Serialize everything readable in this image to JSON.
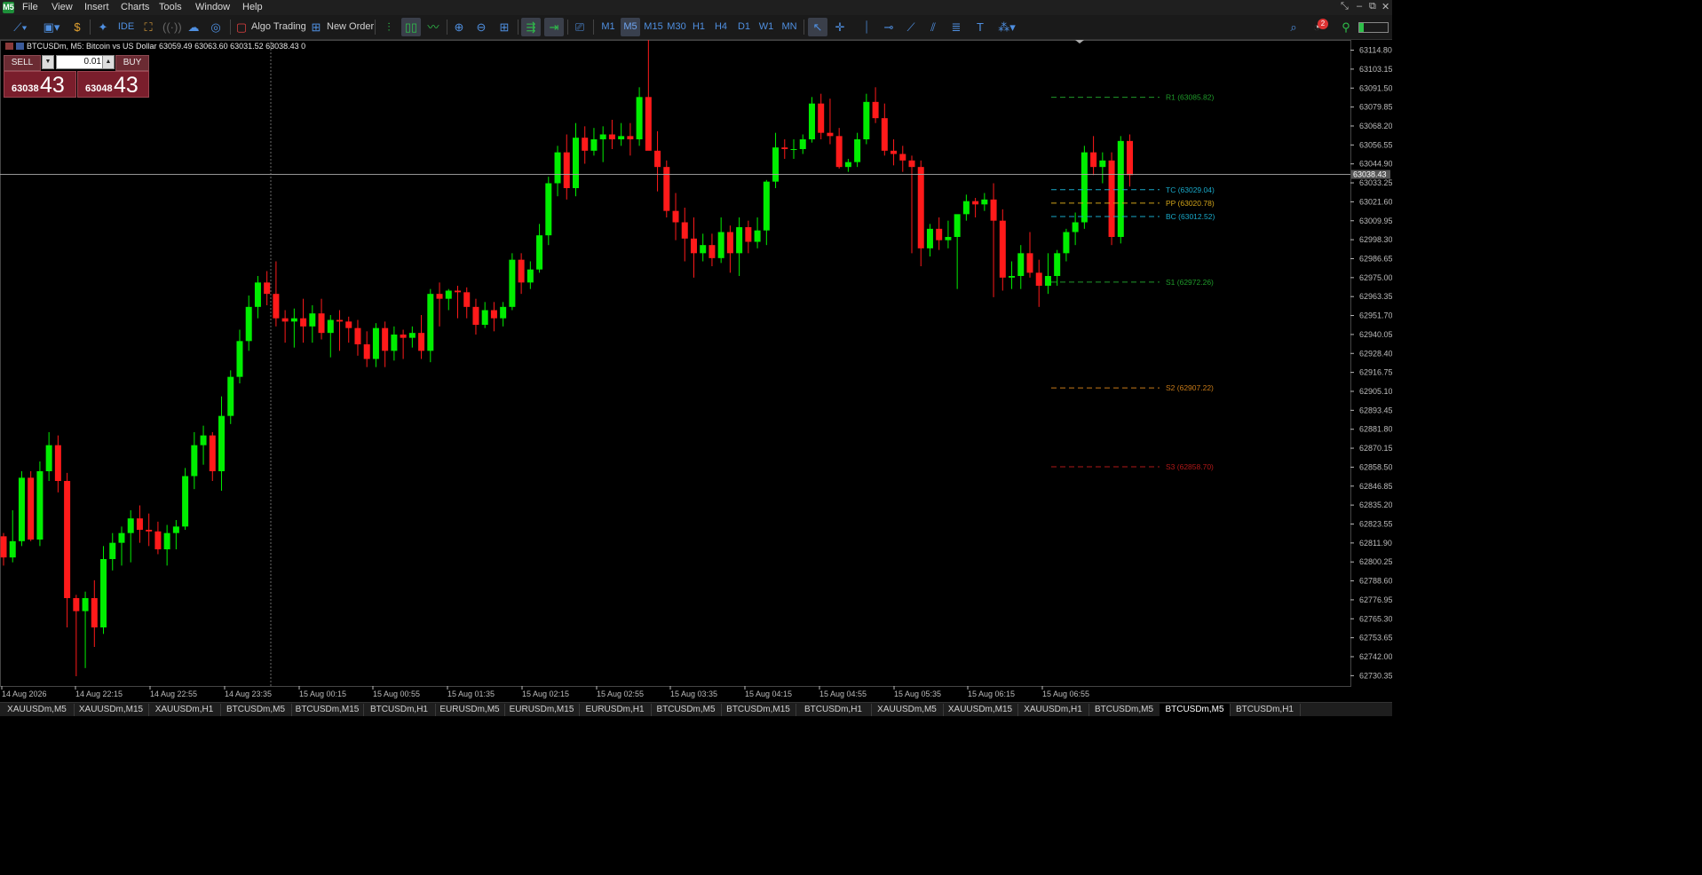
{
  "menu": {
    "logo_label": "M5",
    "items": [
      "File",
      "View",
      "Insert",
      "Charts",
      "Tools",
      "Window",
      "Help"
    ],
    "window_controls": [
      "⤡",
      "–",
      "⧉",
      "✕"
    ]
  },
  "toolbar": {
    "algo_trading_label": "Algo Trading",
    "new_order_label": "New Order",
    "ide_label": "IDE",
    "timeframes": [
      "M1",
      "M5",
      "M15",
      "M30",
      "H1",
      "H4",
      "D1",
      "W1",
      "MN"
    ],
    "active_timeframe": "M5",
    "notifications_count": "2"
  },
  "symbol_info": {
    "text": "BTCUSDm, M5:  Bitcoin vs US Dollar  63059.49 63063.60 63031.52 63038.43  0"
  },
  "trade_panel": {
    "sell_label": "SELL",
    "buy_label": "BUY",
    "lot_value": "0.01",
    "sell_price_small": "63038",
    "sell_price_big": "43",
    "buy_price_small": "63048",
    "buy_price_big": "43"
  },
  "chart_data": {
    "type": "candlestick",
    "symbol": "BTCUSDm",
    "timeframe": "M5",
    "ylim": [
      62724.0,
      63120.0
    ],
    "current_price": 63038.43,
    "current_price_label": "63038.43",
    "y_ticks": [
      "63114.80",
      "63103.15",
      "63091.50",
      "63079.85",
      "63068.20",
      "63056.55",
      "63044.90",
      "63033.25",
      "63021.60",
      "63009.95",
      "62998.30",
      "62986.65",
      "62975.00",
      "62963.35",
      "62951.70",
      "62940.05",
      "62928.40",
      "62916.75",
      "62905.10",
      "62893.45",
      "62881.80",
      "62870.15",
      "62858.50",
      "62846.85",
      "62835.20",
      "62823.55",
      "62811.90",
      "62800.25",
      "62788.60",
      "62776.95",
      "62765.30",
      "62753.65",
      "62742.00",
      "62730.35"
    ],
    "x_tick_labels": [
      "14 Aug 2026",
      "14 Aug 22:15",
      "14 Aug 22:55",
      "14 Aug 23:35",
      "15 Aug 00:15",
      "15 Aug 00:55",
      "15 Aug 01:35",
      "15 Aug 02:15",
      "15 Aug 02:55",
      "15 Aug 03:35",
      "15 Aug 04:15",
      "15 Aug 04:55",
      "15 Aug 05:35",
      "15 Aug 06:15",
      "15 Aug 06:55"
    ],
    "candles": [
      [
        62816,
        62818,
        62798,
        62803
      ],
      [
        62803,
        62832,
        62800,
        62813
      ],
      [
        62813,
        62856,
        62810,
        62852
      ],
      [
        62852,
        62856,
        62813,
        62814
      ],
      [
        62814,
        62862,
        62810,
        62856
      ],
      [
        62856,
        62880,
        62850,
        62872
      ],
      [
        62872,
        62878,
        62843,
        62850
      ],
      [
        62850,
        62855,
        62760,
        62778
      ],
      [
        62778,
        62780,
        62730,
        62770
      ],
      [
        62770,
        62782,
        62735,
        62778
      ],
      [
        62778,
        62789,
        62748,
        62760
      ],
      [
        62760,
        62810,
        62756,
        62802
      ],
      [
        62802,
        62818,
        62795,
        62812
      ],
      [
        62812,
        62822,
        62798,
        62818
      ],
      [
        62818,
        62832,
        62800,
        62827
      ],
      [
        62827,
        62835,
        62812,
        62820
      ],
      [
        62820,
        62830,
        62810,
        62819
      ],
      [
        62819,
        62825,
        62805,
        62808
      ],
      [
        62808,
        62823,
        62798,
        62818
      ],
      [
        62818,
        62826,
        62808,
        62822
      ],
      [
        62822,
        62858,
        62820,
        62853
      ],
      [
        62853,
        62880,
        62845,
        62872
      ],
      [
        62872,
        62884,
        62860,
        62878
      ],
      [
        62878,
        62880,
        62850,
        62856
      ],
      [
        62856,
        62902,
        62844,
        62890
      ],
      [
        62890,
        62918,
        62885,
        62914
      ],
      [
        62914,
        62943,
        62910,
        62936
      ],
      [
        62936,
        62964,
        62930,
        62957
      ],
      [
        62957,
        62976,
        62950,
        62972
      ],
      [
        62972,
        62979,
        62958,
        62965
      ],
      [
        62965,
        62985,
        62945,
        62950
      ],
      [
        62950,
        62955,
        62935,
        62948
      ],
      [
        62948,
        62956,
        62932,
        62950
      ],
      [
        62950,
        62962,
        62935,
        62945
      ],
      [
        62945,
        62958,
        62935,
        62953
      ],
      [
        62953,
        62962,
        62937,
        62941
      ],
      [
        62941,
        62952,
        62926,
        62949
      ],
      [
        62949,
        62955,
        62930,
        62948
      ],
      [
        62948,
        62951,
        62935,
        62944
      ],
      [
        62944,
        62949,
        62927,
        62934
      ],
      [
        62934,
        62942,
        62920,
        62925
      ],
      [
        62925,
        62947,
        62920,
        62944
      ],
      [
        62944,
        62948,
        62920,
        62930
      ],
      [
        62930,
        62945,
        62924,
        62940
      ],
      [
        62940,
        62943,
        62925,
        62938
      ],
      [
        62938,
        62945,
        62932,
        62941
      ],
      [
        62941,
        62952,
        62925,
        62930
      ],
      [
        62930,
        62968,
        62923,
        62965
      ],
      [
        62965,
        62972,
        62945,
        62962
      ],
      [
        62962,
        62968,
        62955,
        62967
      ],
      [
        62967,
        62970,
        62950,
        62966
      ],
      [
        62966,
        62969,
        62950,
        62957
      ],
      [
        62957,
        62962,
        62940,
        62946
      ],
      [
        62946,
        62960,
        62944,
        62955
      ],
      [
        62955,
        62960,
        62942,
        62950
      ],
      [
        62950,
        62960,
        62945,
        62957
      ],
      [
        62957,
        62990,
        62955,
        62986
      ],
      [
        62986,
        62990,
        62965,
        62972
      ],
      [
        62972,
        62985,
        62968,
        62980
      ],
      [
        62980,
        63008,
        62978,
        63001
      ],
      [
        63001,
        63037,
        62995,
        63033
      ],
      [
        63033,
        63056,
        63025,
        63052
      ],
      [
        63052,
        63063,
        63023,
        63030
      ],
      [
        63030,
        63070,
        63025,
        63061
      ],
      [
        63061,
        63068,
        63045,
        63053
      ],
      [
        63053,
        63067,
        63050,
        63060
      ],
      [
        63060,
        63068,
        63046,
        63063
      ],
      [
        63063,
        63072,
        63054,
        63060
      ],
      [
        63060,
        63070,
        63056,
        63062
      ],
      [
        63062,
        63070,
        63050,
        63060
      ],
      [
        63060,
        63092,
        63056,
        63086
      ],
      [
        63086,
        63124,
        63056,
        63053
      ],
      [
        63053,
        63065,
        63028,
        63043
      ],
      [
        63043,
        63047,
        63012,
        63016
      ],
      [
        63016,
        63027,
        62998,
        63009
      ],
      [
        63009,
        63018,
        62985,
        62999
      ],
      [
        62999,
        63012,
        62975,
        62990
      ],
      [
        62990,
        63002,
        62985,
        62995
      ],
      [
        62995,
        63002,
        62982,
        62987
      ],
      [
        62987,
        63012,
        62984,
        63003
      ],
      [
        63003,
        63007,
        62978,
        62990
      ],
      [
        62990,
        63012,
        62976,
        63006
      ],
      [
        63006,
        63010,
        62990,
        62997
      ],
      [
        62997,
        63012,
        62993,
        63004
      ],
      [
        63004,
        63035,
        62995,
        63034
      ],
      [
        63034,
        63064,
        63030,
        63055
      ],
      [
        63055,
        63060,
        63048,
        63054
      ],
      [
        63054,
        63060,
        63048,
        63054
      ],
      [
        63054,
        63063,
        63051,
        63060
      ],
      [
        63060,
        63086,
        63058,
        63082
      ],
      [
        63082,
        63088,
        63060,
        63064
      ],
      [
        63064,
        63085,
        63057,
        63062
      ],
      [
        63062,
        63067,
        63042,
        63043
      ],
      [
        63043,
        63048,
        63040,
        63046
      ],
      [
        63046,
        63064,
        63043,
        63060
      ],
      [
        63060,
        63088,
        63057,
        63083
      ],
      [
        63083,
        63092,
        63070,
        63073
      ],
      [
        63073,
        63082,
        63050,
        63053
      ],
      [
        63053,
        63060,
        63044,
        63051
      ],
      [
        63051,
        63056,
        63040,
        63047
      ],
      [
        63047,
        63050,
        62990,
        63043
      ],
      [
        63043,
        63047,
        62982,
        62993
      ],
      [
        62993,
        63008,
        62988,
        63005
      ],
      [
        63005,
        63012,
        62992,
        62998
      ],
      [
        62998,
        63010,
        62993,
        63000
      ],
      [
        63000,
        63010,
        62968,
        63014
      ],
      [
        63014,
        63026,
        63010,
        63022
      ],
      [
        63022,
        63024,
        63012,
        63020
      ],
      [
        63020,
        63027,
        63016,
        63023
      ],
      [
        63023,
        63033,
        62963,
        63010
      ],
      [
        63010,
        63017,
        62967,
        62975
      ],
      [
        62975,
        62985,
        62968,
        62976
      ],
      [
        62976,
        62995,
        62968,
        62990
      ],
      [
        62990,
        63003,
        62975,
        62978
      ],
      [
        62978,
        62986,
        62957,
        62970
      ],
      [
        62970,
        62990,
        62965,
        62976
      ],
      [
        62976,
        62992,
        62970,
        62990
      ],
      [
        62990,
        63005,
        62985,
        63003
      ],
      [
        63003,
        63015,
        62995,
        63009
      ],
      [
        63009,
        63056,
        63005,
        63052
      ],
      [
        63052,
        63062,
        63038,
        63043
      ],
      [
        63043,
        63052,
        63033,
        63047
      ],
      [
        63047,
        63052,
        62995,
        63000
      ],
      [
        63000,
        63062,
        62996,
        63059
      ],
      [
        63059,
        63063,
        63031,
        63038
      ]
    ]
  },
  "pivots": [
    {
      "id": "r1",
      "label": "R1 (63085.82)",
      "value": 63085.82,
      "color": "#1f9a2a"
    },
    {
      "id": "tc",
      "label": "TC (63029.04)",
      "value": 63029.04,
      "color": "#19a9c9"
    },
    {
      "id": "pp",
      "label": "PP (63020.78)",
      "value": 63020.78,
      "color": "#d0a31a"
    },
    {
      "id": "bc",
      "label": "BC (63012.52)",
      "value": 63012.52,
      "color": "#19a9c9"
    },
    {
      "id": "s1",
      "label": "S1 (62972.26)",
      "value": 62972.26,
      "color": "#1f9a2a"
    },
    {
      "id": "s2",
      "label": "S2 (62907.22)",
      "value": 62907.22,
      "color": "#c77a18"
    },
    {
      "id": "s3",
      "label": "S3 (62858.70)",
      "value": 62858.7,
      "color": "#b01818"
    }
  ],
  "colors": {
    "bull": "#00ee00",
    "bear": "#ff1a1a",
    "axis": "#bbbbbb",
    "crosshair": "#aaaaaa"
  },
  "tabs": [
    {
      "label": "XAUUSDm,M5",
      "active": false
    },
    {
      "label": "XAUUSDm,M15",
      "active": false
    },
    {
      "label": "XAUUSDm,H1",
      "active": false
    },
    {
      "label": "BTCUSDm,M5",
      "active": false
    },
    {
      "label": "BTCUSDm,M15",
      "active": false
    },
    {
      "label": "BTCUSDm,H1",
      "active": false
    },
    {
      "label": "EURUSDm,M5",
      "active": false
    },
    {
      "label": "EURUSDm,M15",
      "active": false
    },
    {
      "label": "EURUSDm,H1",
      "active": false
    },
    {
      "label": "BTCUSDm,M5",
      "active": false
    },
    {
      "label": "BTCUSDm,M15",
      "active": false
    },
    {
      "label": "BTCUSDm,H1",
      "active": false
    },
    {
      "label": "XAUUSDm,M5",
      "active": false
    },
    {
      "label": "XAUUSDm,M15",
      "active": false
    },
    {
      "label": "XAUUSDm,H1",
      "active": false
    },
    {
      "label": "BTCUSDm,M5",
      "active": false
    },
    {
      "label": "BTCUSDm,M5",
      "active": true
    },
    {
      "label": "BTCUSDm,H1",
      "active": false
    }
  ]
}
